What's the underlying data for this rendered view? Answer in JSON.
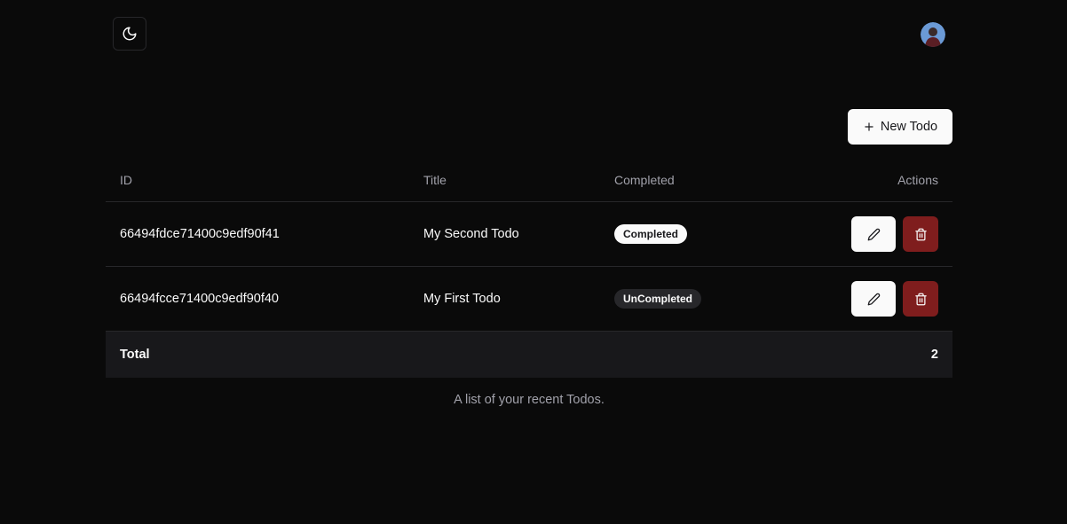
{
  "header": {
    "theme_toggle_icon": "moon-icon",
    "avatar_icon": "user-avatar"
  },
  "toolbar": {
    "new_todo_label": "New Todo",
    "new_todo_icon": "plus-icon"
  },
  "table": {
    "columns": [
      "ID",
      "Title",
      "Completed",
      "Actions"
    ],
    "rows": [
      {
        "id": "66494fdce71400c9edf90f41",
        "title": "My Second Todo",
        "status": "Completed"
      },
      {
        "id": "66494fcce71400c9edf90f40",
        "title": "My First Todo",
        "status": "UnCompleted"
      }
    ],
    "footer": {
      "label": "Total",
      "value": "2"
    },
    "caption": "A list of your recent Todos."
  },
  "colors": {
    "background": "#0a0a0a",
    "delete_button": "#7f1d1d",
    "muted_text": "#a1a1aa"
  }
}
